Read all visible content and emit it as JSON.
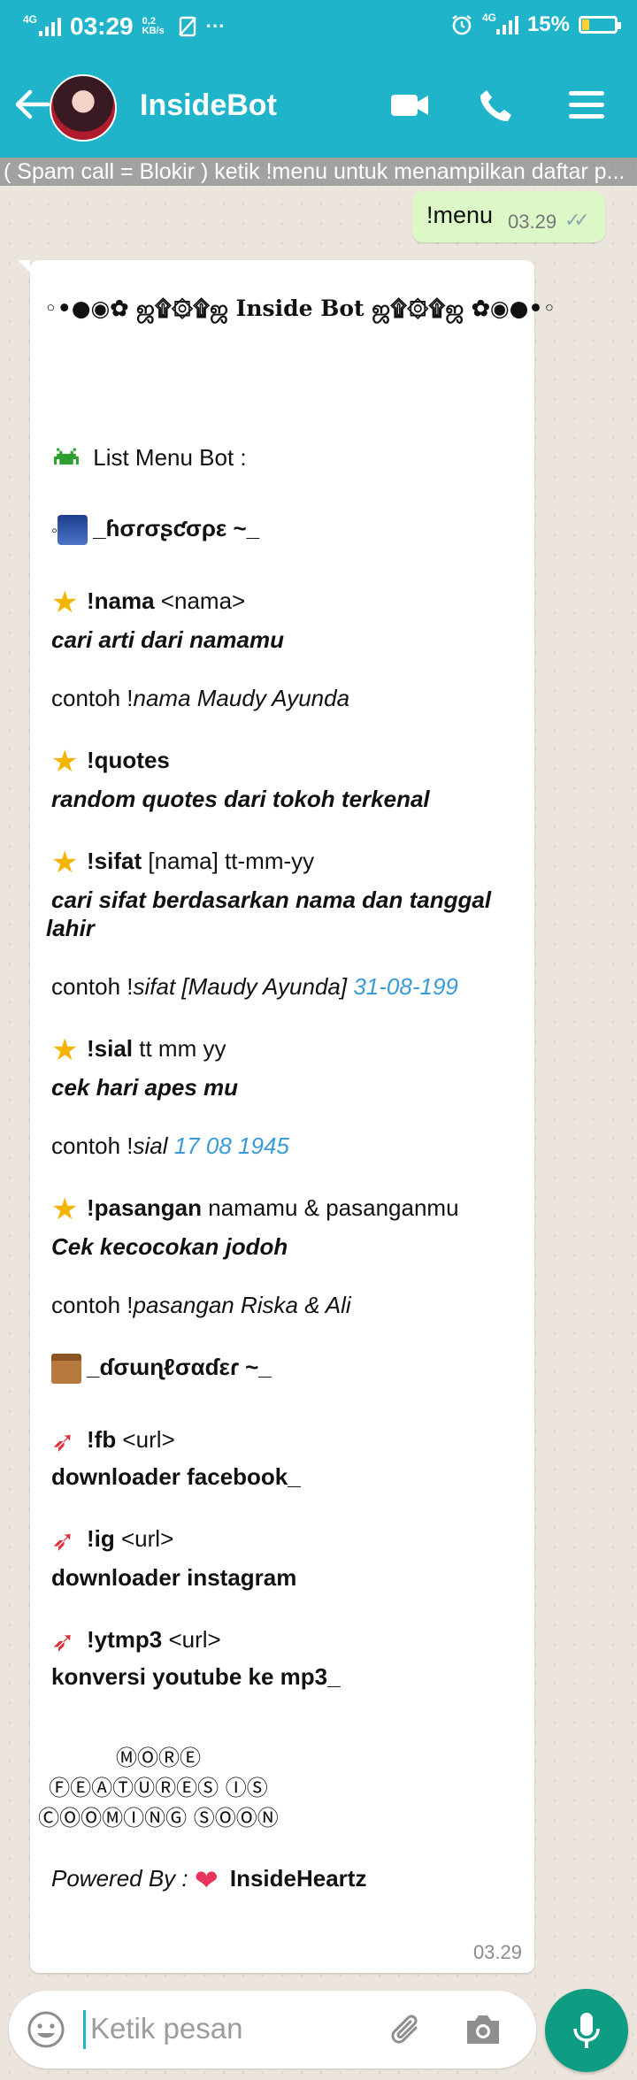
{
  "status_bar": {
    "network_left": "4G",
    "time": "03:29",
    "data_speed": "0,2 KB/s",
    "network_right": "4G",
    "battery": "15%",
    "colors": {
      "bar": "#1fb4c9",
      "battery_fill": "#f8d230"
    }
  },
  "header": {
    "title": "InsideBot",
    "icons": [
      "back-arrow-icon",
      "video-call-icon",
      "phone-icon",
      "menu-icon"
    ]
  },
  "marquee": {
    "text": "( Spam call = Blokir ) ketik !menu untuk menampilkan daftar p..."
  },
  "outgoing": {
    "text": "!menu",
    "time": "03.29"
  },
  "bot_message": {
    "header": "◦•●◉✿ ஜ۩۞۩ஜ Inside Bot ஜ۩۞۩ஜ ✿◉●•◦",
    "list_title": "List Menu Bot :",
    "horoscope_section": "_ɦσɾσʂƈσρε ~_",
    "items": [
      {
        "cmd": "!nama",
        "args": " <nama>",
        "desc": "cari arti dari namamu",
        "example_prefix": "contoh !",
        "example": "nama Maudy Ayunda",
        "example_link": ""
      },
      {
        "cmd": "!quotes",
        "args": "",
        "desc": "random quotes dari tokoh terkenal"
      },
      {
        "cmd": "!sifat",
        "args": " [nama] tt-mm-yy",
        "desc": "cari sifat berdasarkan nama dan tanggal",
        "desc2": "lahir",
        "example_prefix": "contoh !",
        "example": "sifat [Maudy Ayunda] ",
        "example_link": "31-08-199"
      },
      {
        "cmd": "!sial",
        "args": " tt mm yy",
        "desc": "cek hari apes mu",
        "example_prefix": "contoh !",
        "example": "sial ",
        "example_link": "17 08 1945"
      },
      {
        "cmd": "!pasangan",
        "args": " namamu & pasanganmu",
        "desc": "Cek kecocokan jodoh",
        "example_prefix": "contoh !",
        "example": "pasangan Riska & Ali",
        "example_link": ""
      }
    ],
    "downloader_section": "_ɗσɯɳℓσαɗεɾ ~_",
    "downloads": [
      {
        "cmd": "!fb",
        "args": " <url>",
        "desc": "downloader facebook_"
      },
      {
        "cmd": "!ig",
        "args": " <url>",
        "desc": "downloader instagram"
      },
      {
        "cmd": "!ytmp3",
        "args": " <url>",
        "desc": "konversi youtube ke mp3_"
      }
    ],
    "more_lines": [
      "ⓂⓄⓇⒺ",
      "ⒻⒺⒶⓉⓊⓇⒺⓈ ⒾⓈ",
      "ⒸⓄⓄⓂⒾⓃⒼ ⓈⓄⓄⓃ"
    ],
    "powered_prefix": "Powered By : ",
    "powered_name": "InsideHeartz",
    "time": "03.29"
  },
  "input": {
    "placeholder": "Ketik pesan",
    "icons": [
      "emoji-icon",
      "attach-icon",
      "camera-icon",
      "mic-icon"
    ]
  }
}
